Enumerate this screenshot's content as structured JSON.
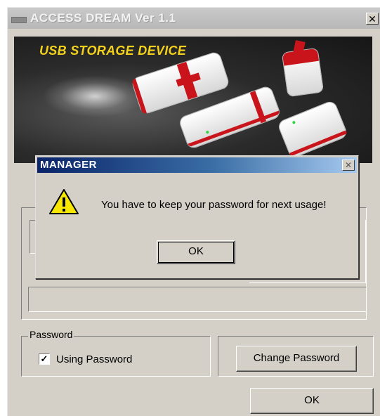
{
  "window": {
    "title": "ACCESS DREAM Ver 1.1",
    "close_glyph": "✕"
  },
  "banner": {
    "title": "USB STORAGE DEVICE"
  },
  "password_group": {
    "label": "Password",
    "checkbox_label": "Using Password",
    "checked": true,
    "change_button": "Change Password"
  },
  "main_ok": "OK",
  "dialog": {
    "title": "MANAGER",
    "close_glyph": "✕",
    "message": "You have to keep your password for next usage!",
    "ok": "OK",
    "icon": "warning-icon"
  },
  "colors": {
    "title_yellow": "#f4d21b",
    "dialog_title_start": "#0a246a",
    "dialog_title_end": "#a6caf0",
    "usb_red": "#c8141a"
  }
}
